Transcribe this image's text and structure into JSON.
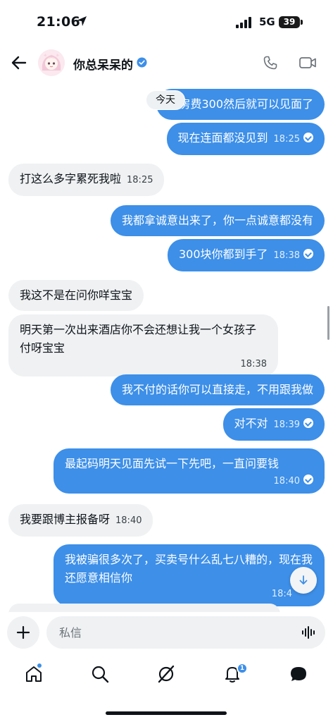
{
  "status_bar": {
    "time": "21:06",
    "network": "5G",
    "battery": "39"
  },
  "header": {
    "name": "你总呆呆的",
    "back_icon": "arrow-left-icon",
    "call_icon": "phone-icon",
    "video_icon": "video-camera-icon",
    "verified": true
  },
  "date_divider": "今天",
  "messages": [
    {
      "side": "out",
      "text": "开房费300然后就可以见面了",
      "time": ""
    },
    {
      "side": "out",
      "text": "现在连面都没见到",
      "time": "18:25"
    },
    {
      "side": "in",
      "text": "打这么多字累死我啦",
      "time": "18:25"
    },
    {
      "side": "out",
      "text": "我都拿诚意出来了，你一点诚意都没有",
      "time": ""
    },
    {
      "side": "out",
      "text": "300块你都到手了",
      "time": "18:38"
    },
    {
      "side": "in",
      "text": "我这不是在问你咩宝宝",
      "time": ""
    },
    {
      "side": "in",
      "text": "明天第一次出来酒店你不会还想让我一个女孩子付呀宝宝",
      "time": "18:38"
    },
    {
      "side": "out",
      "text": "我不付的话你可以直接走，不用跟我做",
      "time": ""
    },
    {
      "side": "out",
      "text": "对不对",
      "time": "18:39"
    },
    {
      "side": "out",
      "text": "最起码明天见面先试一下先吧，一直问要钱",
      "time": "18:40"
    },
    {
      "side": "in",
      "text": "我要跟博主报备呀",
      "time": "18:40"
    },
    {
      "side": "out",
      "text": "我被骗很多次了，买卖号什么乱七八糟的，现在我还愿意相信你",
      "time": "18:4"
    }
  ],
  "composer": {
    "placeholder": "私信",
    "add_icon": "plus-icon",
    "voice_icon": "voice-waveform-icon"
  },
  "tab_bar": {
    "items": [
      "home-icon",
      "search-icon",
      "grok-icon",
      "bell-icon",
      "messages-icon"
    ],
    "notification_count": "1"
  },
  "colors": {
    "accent": "#3d8fe8",
    "incoming_bubble": "#eff1f3",
    "text": "#0f1419"
  }
}
